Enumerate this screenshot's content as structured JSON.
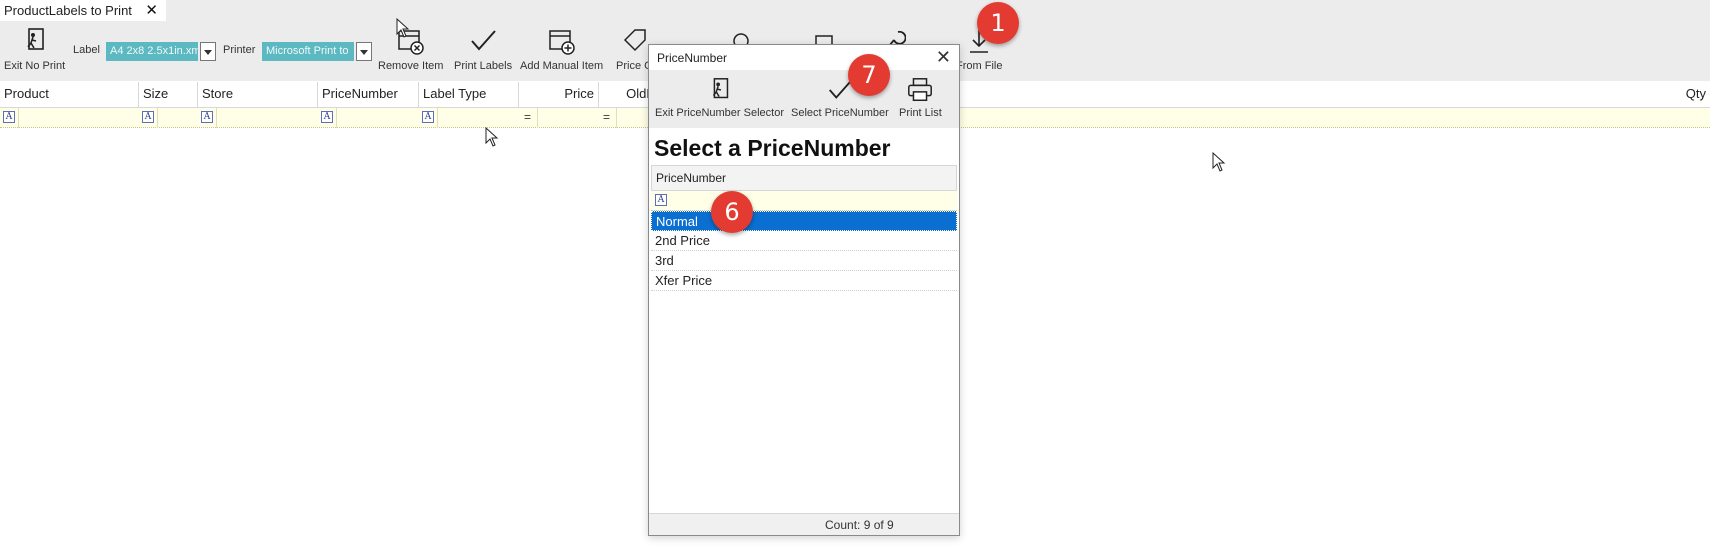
{
  "tab": {
    "title": "ProductLabels to Print",
    "close": "✕"
  },
  "toolbar": {
    "exit_no_print": "Exit No Print",
    "label_caption": "Label",
    "label_value": "A4 2x8 2.5x1in.xm",
    "printer_caption": "Printer",
    "printer_value": "Microsoft Print to",
    "remove_item": "Remove Item",
    "print_labels": "Print Labels",
    "add_manual_item": "Add Manual Item",
    "price_change_partial": "Price C",
    "from_file_partial": "From File"
  },
  "grid": {
    "columns": [
      "Product",
      "Size",
      "Store",
      "PriceNumber",
      "Label Type",
      "Price",
      "OldP",
      "Qty"
    ],
    "filter_icon": "A",
    "filter_eq": "="
  },
  "dialog": {
    "title": "PriceNumber",
    "close": "✕",
    "exit_selector": "Exit PriceNumber Selector",
    "select_price_number": "Select PriceNumber",
    "print_list": "Print List",
    "heading": "Select a PriceNumber",
    "column_header": "PriceNumber",
    "items": [
      "Normal",
      "2nd Price",
      "3rd",
      "Xfer Price"
    ],
    "selected_index": 0,
    "count": "Count: 9 of 9"
  },
  "badges": [
    "1",
    "7",
    "6"
  ],
  "colors": {
    "accent_badge": "#e33b31",
    "selection": "#0a6fd1",
    "combo": "#5cb8c1",
    "filter_row": "#fffee6"
  }
}
